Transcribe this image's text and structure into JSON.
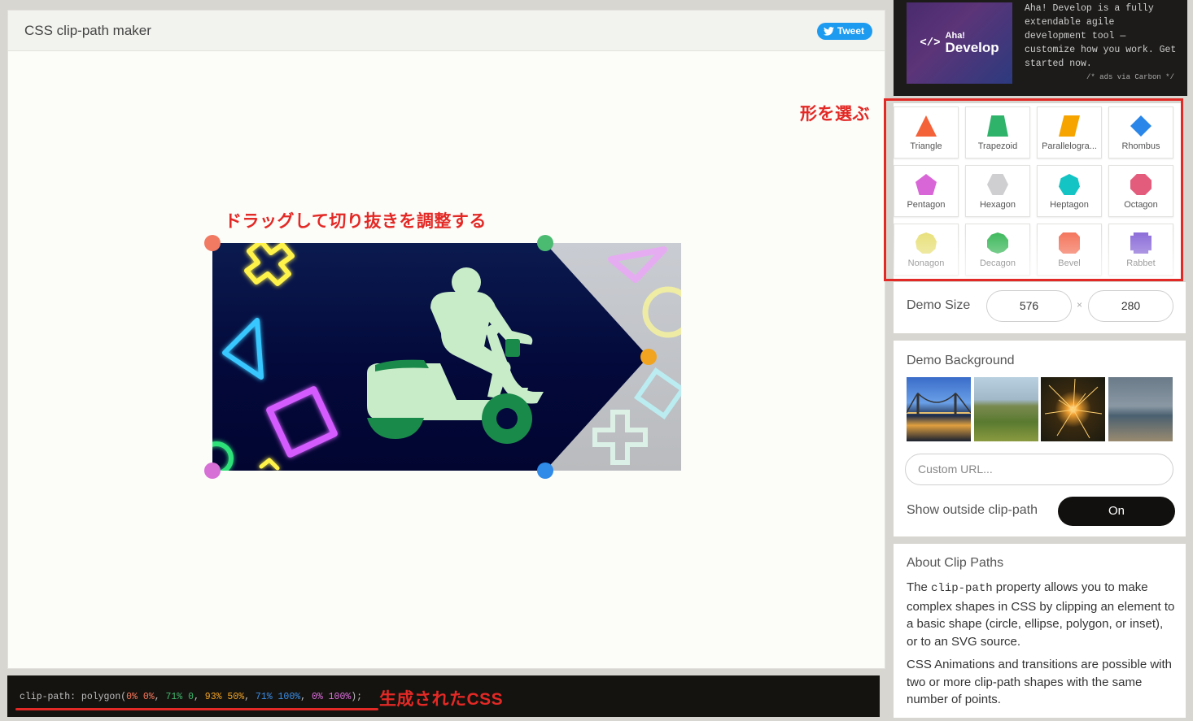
{
  "header": {
    "title": "CSS clip-path maker",
    "tweet_label": "Tweet"
  },
  "annotations": {
    "drag": "ドラッグして切り抜きを調整する",
    "choose_shape": "形を選ぶ",
    "generated_css": "生成されたCSS"
  },
  "code": {
    "property": "clip-path:",
    "func": "polygon(",
    "points": [
      {
        "text": "0% 0%",
        "color": "#ff7a5c"
      },
      {
        "text": "71% 0",
        "color": "#3fb86b"
      },
      {
        "text": "93% 50%",
        "color": "#f5a623"
      },
      {
        "text": "71% 100%",
        "color": "#3b8fe8"
      },
      {
        "text": "0% 100%",
        "color": "#e070e0"
      }
    ],
    "close": ");"
  },
  "ad": {
    "logo_small": "Aha!",
    "logo_big": "Develop",
    "text": "Aha! Develop is a fully extendable agile development tool — customize how you work. Get started now.",
    "via": "/* ads via Carbon */"
  },
  "shapes": [
    {
      "label": "Triangle",
      "color": "#f4623a"
    },
    {
      "label": "Trapezoid",
      "color": "#2fb36a"
    },
    {
      "label": "Parallelogra...",
      "color": "#f5a400"
    },
    {
      "label": "Rhombus",
      "color": "#2a86e8"
    },
    {
      "label": "Pentagon",
      "color": "#d966d6"
    },
    {
      "label": "Hexagon",
      "color": "#cfcfd2"
    },
    {
      "label": "Heptagon",
      "color": "#14c4c4"
    },
    {
      "label": "Octagon",
      "color": "#e45c7c"
    },
    {
      "label": "Nonagon",
      "color": "#e8e07a"
    },
    {
      "label": "Decagon",
      "color": "#3cb85a"
    },
    {
      "label": "Bevel",
      "color": "#f4735a"
    },
    {
      "label": "Rabbet",
      "color": "#8a6ad8"
    }
  ],
  "demo_size": {
    "label": "Demo Size",
    "width": "576",
    "height": "280",
    "separator": "×"
  },
  "demo_background": {
    "label": "Demo Background",
    "url_placeholder": "Custom URL...",
    "show_outside_label": "Show outside clip-path",
    "toggle_label": "On"
  },
  "about": {
    "title": "About Clip Paths",
    "p1_before": "The ",
    "p1_code": "clip-path",
    "p1_after": " property allows you to make complex shapes in CSS by clipping an element to a basic shape (circle, ellipse, polygon, or inset), or to an SVG source.",
    "p2": "CSS Animations and transitions are possible with two or more clip-path shapes with the same number of points."
  }
}
